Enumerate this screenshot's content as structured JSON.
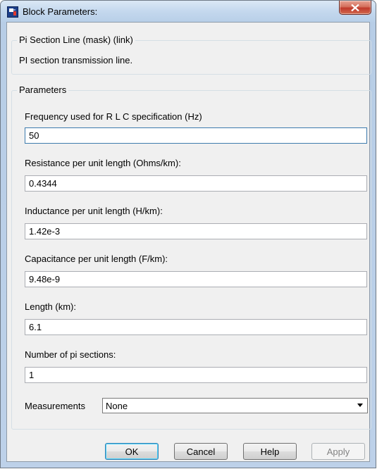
{
  "window": {
    "title": "Block Parameters:"
  },
  "mask": {
    "heading": "Pi Section Line (mask) (link)",
    "description": "PI section transmission line."
  },
  "parameters": {
    "heading": "Parameters",
    "fields": [
      {
        "label": "Frequency used for R L C specification (Hz)",
        "value": "50"
      },
      {
        "label": "Resistance per unit length (Ohms/km):",
        "value": "0.4344"
      },
      {
        "label": "Inductance per unit length (H/km):",
        "value": "1.42e-3"
      },
      {
        "label": "Capacitance per unit length (F/km):",
        "value": "9.48e-9"
      },
      {
        "label": "Length (km):",
        "value": "6.1"
      },
      {
        "label": "Number of pi sections:",
        "value": "1"
      }
    ],
    "measurements": {
      "label": "Measurements",
      "selected": "None"
    }
  },
  "buttons": {
    "ok": "OK",
    "cancel": "Cancel",
    "help": "Help",
    "apply": "Apply"
  }
}
